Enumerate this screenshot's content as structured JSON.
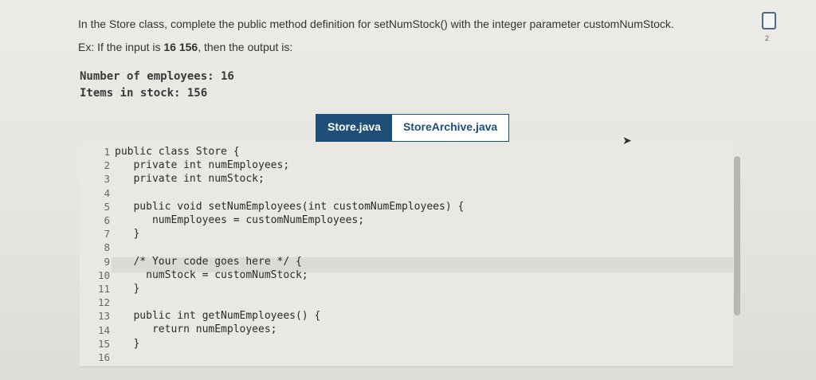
{
  "prompt": {
    "text": "In the Store class, complete the public method definition for setNumStock() with the integer parameter customNumStock.",
    "example_prefix": "Ex: If the input is ",
    "example_input": "16  156",
    "example_suffix": ", then the output is:"
  },
  "output": {
    "lines": [
      "Number of employees: 16",
      "Items in stock: 156"
    ]
  },
  "tabs": [
    {
      "label": "Store.java"
    },
    {
      "label": "StoreArchive.java"
    }
  ],
  "editor": {
    "line_numbers": [
      "1",
      "2",
      "3",
      "4",
      "5",
      "6",
      "7",
      "8",
      "9",
      "10",
      "11",
      "12",
      "13",
      "14",
      "15",
      "16"
    ],
    "code_lines": [
      "public class Store {",
      "   private int numEmployees;",
      "   private int numStock;",
      "",
      "   public void setNumEmployees(int customNumEmployees) {",
      "      numEmployees = customNumEmployees;",
      "   }",
      "",
      "   /* Your code goes here */ {",
      "     numStock = customNumStock;",
      "   }",
      "",
      "   public int getNumEmployees() {",
      "      return numEmployees;",
      "   }",
      ""
    ]
  },
  "status": {
    "check_count": "2"
  },
  "colors": {
    "tab_active": "#1f4e79"
  }
}
